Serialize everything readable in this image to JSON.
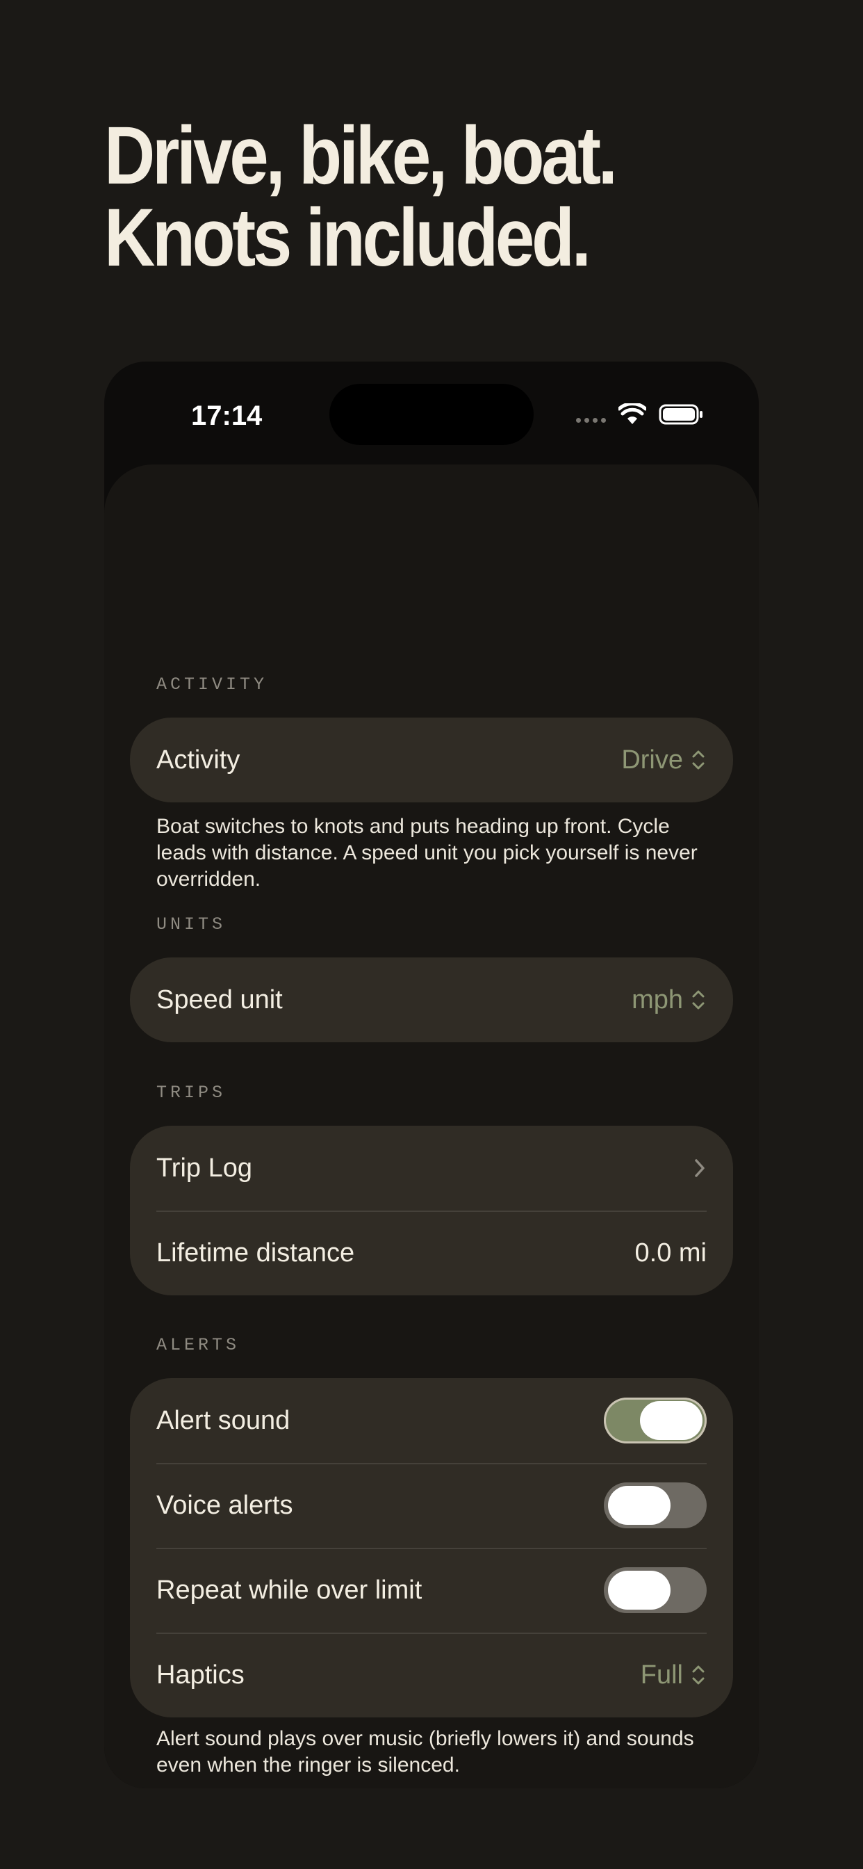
{
  "headline": {
    "line1": "Drive, bike, boat.",
    "line2": "Knots included."
  },
  "status_bar": {
    "time": "17:14",
    "signal_icon": "signal-dots-icon",
    "wifi_icon": "wifi-icon",
    "battery_icon": "battery-icon"
  },
  "sections": {
    "activity": {
      "label": "ACTIVITY",
      "row_label": "Activity",
      "row_value": "Drive",
      "footnote": "Boat switches to knots and puts heading up front. Cycle leads with distance. A speed unit you pick yourself is never overridden."
    },
    "units": {
      "label": "UNITS",
      "row_label": "Speed unit",
      "row_value": "mph"
    },
    "trips": {
      "label": "TRIPS",
      "trip_log_label": "Trip Log",
      "lifetime_label": "Lifetime distance",
      "lifetime_value": "0.0 mi"
    },
    "alerts": {
      "label": "ALERTS",
      "alert_sound_label": "Alert sound",
      "alert_sound_on": true,
      "voice_alerts_label": "Voice alerts",
      "voice_alerts_on": false,
      "repeat_label": "Repeat while over limit",
      "repeat_on": false,
      "haptics_label": "Haptics",
      "haptics_value": "Full",
      "footnote": "Alert sound plays over music (briefly lowers it) and sounds even when the ringer is silenced."
    }
  },
  "colors": {
    "background": "#1b1916",
    "card": "#302c25",
    "accent": "#8e9775",
    "toggle_on": "#7d8865"
  }
}
